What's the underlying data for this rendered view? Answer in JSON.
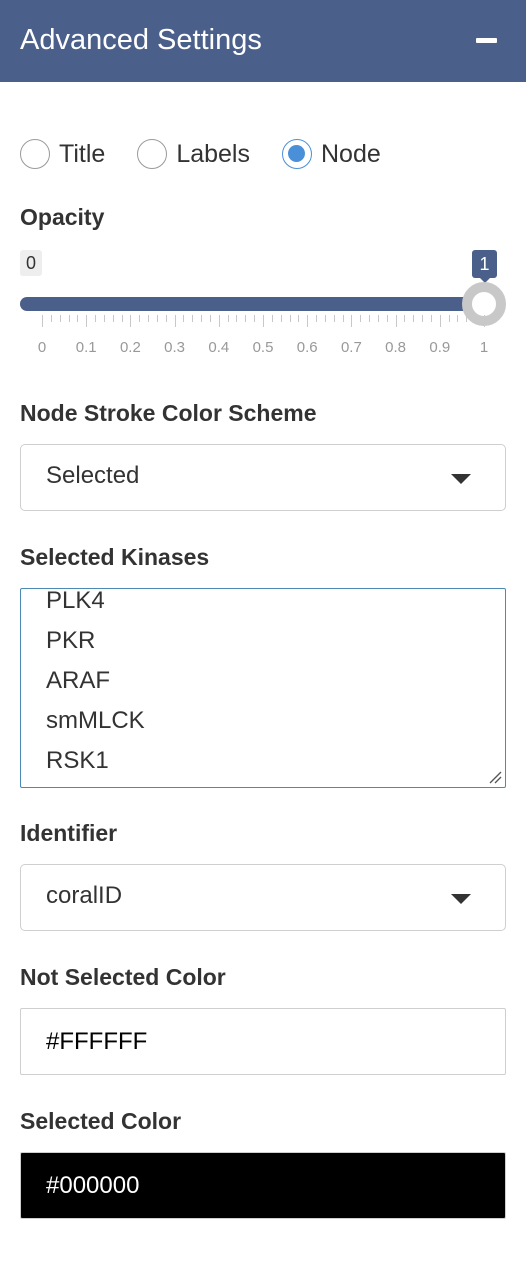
{
  "panel": {
    "title": "Advanced Settings"
  },
  "radio": {
    "options": [
      {
        "label": "Title",
        "checked": false
      },
      {
        "label": "Labels",
        "checked": false
      },
      {
        "label": "Node",
        "checked": true
      }
    ]
  },
  "opacity": {
    "label": "Opacity",
    "min_label": "0",
    "value_label": "1",
    "value": 1,
    "min": 0,
    "max": 1,
    "tick_labels": [
      "0",
      "0.1",
      "0.2",
      "0.3",
      "0.4",
      "0.5",
      "0.6",
      "0.7",
      "0.8",
      "0.9",
      "1"
    ],
    "color": "#4a5f8a"
  },
  "stroke_scheme": {
    "label": "Node Stroke Color Scheme",
    "value": "Selected"
  },
  "kinases": {
    "label": "Selected Kinases",
    "items": [
      "PLK4",
      "PKR",
      "ARAF",
      "smMLCK",
      "RSK1"
    ]
  },
  "identifier": {
    "label": "Identifier",
    "value": "coralID"
  },
  "not_selected_color": {
    "label": "Not Selected Color",
    "value": "#FFFFFF"
  },
  "selected_color": {
    "label": "Selected Color",
    "value": "#000000"
  },
  "colors": {
    "header": "#4a5f8a",
    "radio_accent": "#4a90d9",
    "listbox_border": "#4a8ab5"
  }
}
